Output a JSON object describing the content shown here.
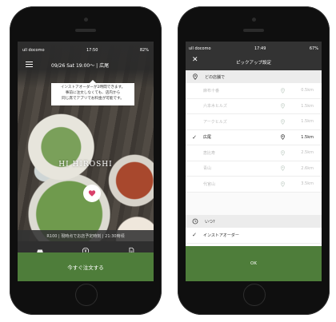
{
  "left": {
    "status": {
      "carrier": "ull docomo",
      "time": "17:50",
      "battery": "82%"
    },
    "schedule": "09/26 Sat 19:00〜",
    "location": "広尾",
    "tooltip": {
      "line1": "インストアオーダーが2時間できます。",
      "line2": "事前に注文しなくても、店内から",
      "line3": "同じ席でアプリでお料金が可能です。"
    },
    "shop_name": "HI HIROSHI",
    "info": "R100 | 現時点でお店予定時刻 | 21:30時頃",
    "order_button": "今すぐ注文する",
    "accent": "#4e7d3a"
  },
  "right": {
    "status": {
      "carrier": "ull docomo",
      "time": "17:49",
      "battery": "67%"
    },
    "title": "ピックアップ設定",
    "store_section": "どの店舗で",
    "stores": [
      {
        "name": "麻布十番",
        "distance": "0.5km",
        "selected": false
      },
      {
        "name": "六本木ヒルズ",
        "distance": "1.5km",
        "selected": false
      },
      {
        "name": "アークヒルズ",
        "distance": "1.5km",
        "selected": false
      },
      {
        "name": "広尾",
        "distance": "1.5km",
        "selected": true
      },
      {
        "name": "恵比寿",
        "distance": "2.5km",
        "selected": false
      },
      {
        "name": "青山",
        "distance": "2.6km",
        "selected": false
      },
      {
        "name": "代官山",
        "distance": "3.5km",
        "selected": false
      }
    ],
    "time_section": "いつ?",
    "time_options": [
      {
        "label": "インストアオーダー",
        "selected": true
      },
      {
        "label": "有効時間で予約",
        "selected": false
      }
    ],
    "ok_button": "OK"
  }
}
